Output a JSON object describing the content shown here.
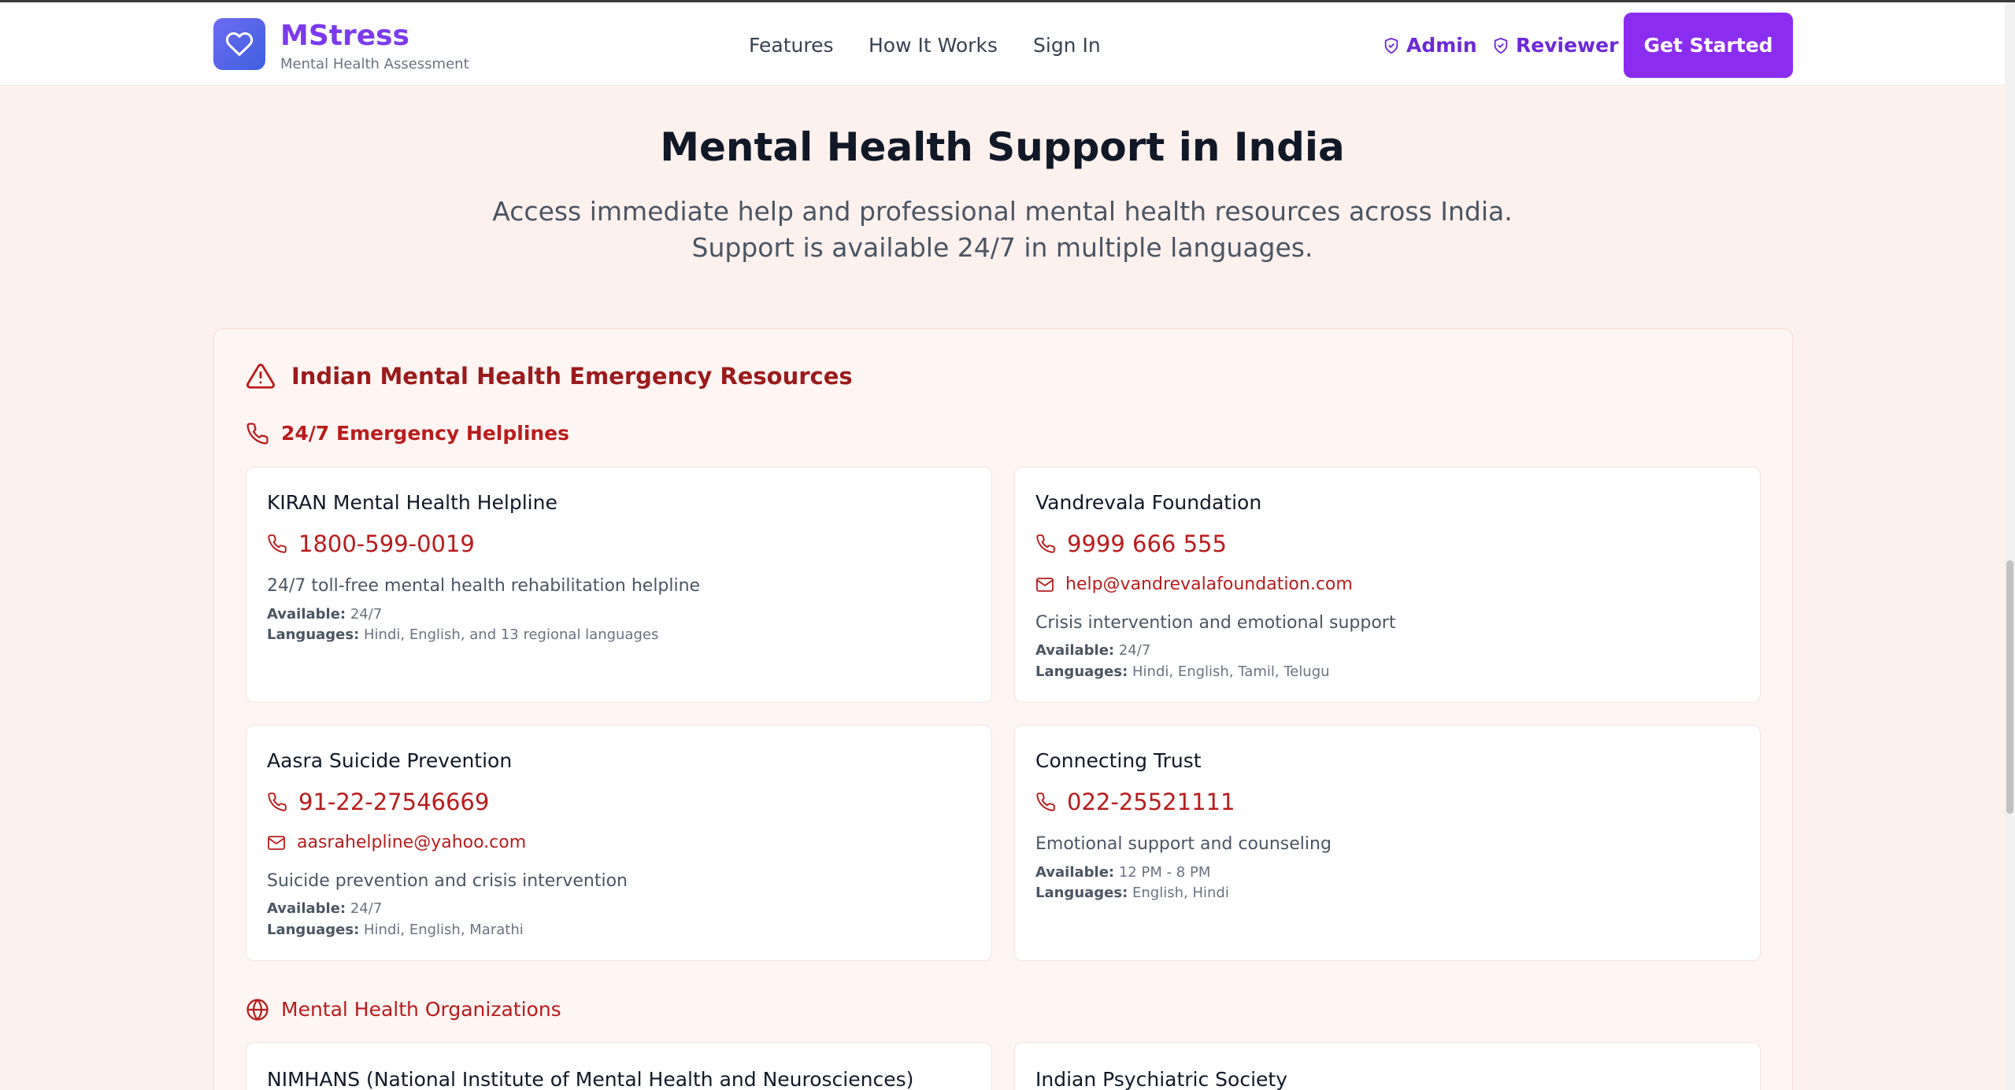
{
  "header": {
    "brand": "MStress",
    "tagline": "Mental Health Assessment",
    "nav": [
      "Features",
      "How It Works",
      "Sign In"
    ],
    "roles": [
      "Admin",
      "Reviewer"
    ],
    "cta": "Get Started"
  },
  "hero": {
    "title": "Mental Health Support in India",
    "subtitle": "Access immediate help and professional mental health resources across India. Support is available 24/7 in multiple languages."
  },
  "resources": {
    "title": "Indian Mental Health Emergency Resources",
    "helplines_title": "24/7 Emergency Helplines",
    "available_label": "Available:",
    "languages_label": "Languages:",
    "helplines": [
      {
        "name": "KIRAN Mental Health Helpline",
        "phone": "1800-599-0019",
        "email": "",
        "description": "24/7 toll-free mental health rehabilitation helpline",
        "available": "24/7",
        "languages": "Hindi, English, and 13 regional languages"
      },
      {
        "name": "Vandrevala Foundation",
        "phone": "9999 666 555",
        "email": "help@vandrevalafoundation.com",
        "description": "Crisis intervention and emotional support",
        "available": "24/7",
        "languages": "Hindi, English, Tamil, Telugu"
      },
      {
        "name": "Aasra Suicide Prevention",
        "phone": "91-22-27546669",
        "email": "aasrahelpline@yahoo.com",
        "description": "Suicide prevention and crisis intervention",
        "available": "24/7",
        "languages": "Hindi, English, Marathi"
      },
      {
        "name": "Connecting Trust",
        "phone": "022-25521111",
        "email": "",
        "description": "Emotional support and counseling",
        "available": "12 PM - 8 PM",
        "languages": "English, Hindi"
      }
    ],
    "orgs_title": "Mental Health Organizations",
    "organizations": [
      {
        "name": "NIMHANS (National Institute of Mental Health and Neurosciences)"
      },
      {
        "name": "Indian Psychiatric Society"
      }
    ]
  },
  "colors": {
    "brand": "#7c3aed",
    "cta": "#8b2df0",
    "accent_red": "#b91c1c",
    "background": "#fdf1ee"
  }
}
